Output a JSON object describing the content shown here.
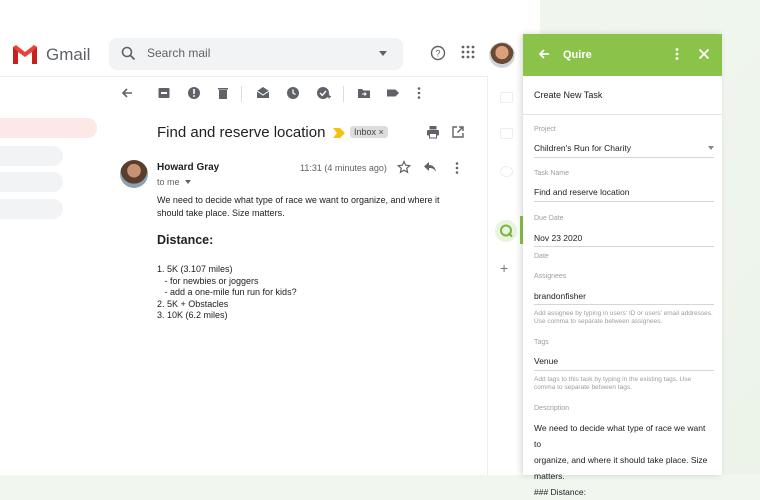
{
  "gmail": {
    "app_name": "Gmail",
    "search_placeholder": "Search mail"
  },
  "message": {
    "subject": "Find and reserve location",
    "label": "Inbox ×",
    "sender": "Howard Gray",
    "recipient": "to me",
    "time": "11:31 (4 minutes ago)",
    "body": "We need to decide what type of race we want to organize, and where it should take place. Size matters.",
    "heading": "Distance:",
    "list": [
      "1. 5K (3.107 miles)",
      "   - for newbies or joggers",
      "   - add a one-mile fun run for kids?",
      "2. 5K + Obstacles",
      "3. 10K (6.2 miles)"
    ]
  },
  "quire": {
    "title": "Quire",
    "create_label": "Create New Task",
    "project_label": "Project",
    "project_value": "Children's Run for Charity",
    "task_name_label": "Task Name",
    "task_name_value": "Find and reserve location",
    "due_label": "Due Date",
    "due_value": "Nov 23 2020",
    "date_label": "Date",
    "assignees_label": "Assignees",
    "assignees_value": "brandonfisher",
    "assignees_hint": "Add assignee by typing in users' ID or users' email addresses. Use comma to separate between assignees.",
    "tags_label": "Tags",
    "tags_value": "Venue",
    "tags_hint": "Add tags to this task by typing in the existing tags. Use comma to separate between tags.",
    "description_label": "Description",
    "description_lines": [
      "We need to decide what type of race we want to",
      "organize, and where it should take place. Size",
      "matters.",
      "### Distance:"
    ]
  },
  "colors": {
    "quire_green": "#8bc34a",
    "gmail_red": "#ea4335"
  }
}
